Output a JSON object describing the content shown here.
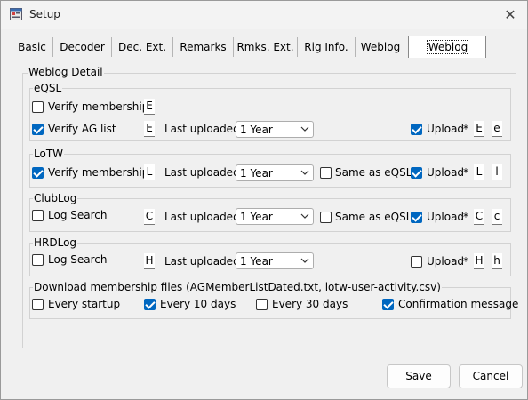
{
  "window": {
    "title": "Setup"
  },
  "tabs": [
    "Basic",
    "Decoder",
    "Dec. Ext.",
    "Remarks",
    "Rmks. Ext.",
    "Rig Info.",
    "Weblog",
    "Weblog Detail"
  ],
  "outer_label": "Weblog Detail",
  "common": {
    "last_uploaded": "Last uploaded",
    "upload": "Upload",
    "same_as_eqsl": "Same as eQSL",
    "star": "*"
  },
  "eqsl": {
    "label": "eQSL",
    "verify_membership": {
      "label": "Verify membership",
      "checked": false,
      "code": "E"
    },
    "verify_ag": {
      "label": "Verify AG list",
      "checked": true,
      "code": "E"
    },
    "interval": "1 Year",
    "upload_checked": true,
    "upload_codes": [
      "E",
      "e"
    ]
  },
  "lotw": {
    "label": "LoTW",
    "verify_membership": {
      "label": "Verify membership",
      "checked": true,
      "code": "L"
    },
    "interval": "1 Year",
    "same_checked": false,
    "upload_checked": true,
    "upload_codes": [
      "L",
      "l"
    ]
  },
  "clublog": {
    "label": "ClubLog",
    "log_search": {
      "label": "Log Search",
      "checked": false,
      "code": "C"
    },
    "interval": "1 Year",
    "same_checked": false,
    "upload_checked": true,
    "upload_codes": [
      "C",
      "c"
    ]
  },
  "hrdlog": {
    "label": "HRDLog",
    "log_search": {
      "label": "Log Search",
      "checked": false,
      "code": "H"
    },
    "interval": "1 Year",
    "upload_checked": false,
    "upload_codes": [
      "H",
      "h"
    ]
  },
  "download": {
    "label": "Download membership files (AGMemberListDated.txt, lotw-user-activity.csv)",
    "every_startup": {
      "label": "Every startup",
      "checked": false
    },
    "every_10": {
      "label": "Every 10 days",
      "checked": true
    },
    "every_30": {
      "label": "Every 30 days",
      "checked": false
    },
    "confirmation": {
      "label": "Confirmation message",
      "checked": true
    }
  },
  "buttons": {
    "save": "Save",
    "cancel": "Cancel"
  }
}
